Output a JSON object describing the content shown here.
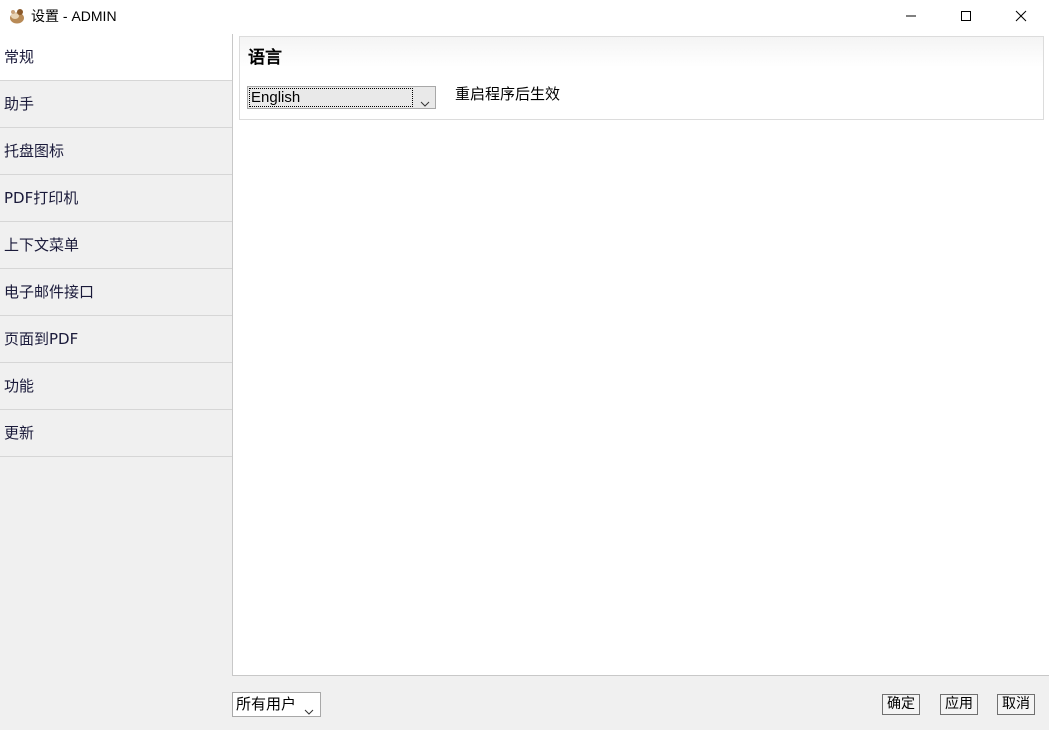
{
  "window": {
    "title": "设置 - ADMIN"
  },
  "sidebar": {
    "items": [
      {
        "label": "常规",
        "active": true
      },
      {
        "label": "助手"
      },
      {
        "label": "托盘图标"
      },
      {
        "label": "PDF打印机"
      },
      {
        "label": "上下文菜单"
      },
      {
        "label": "电子邮件接口"
      },
      {
        "label": "页面到PDF"
      },
      {
        "label": "功能"
      },
      {
        "label": "更新"
      }
    ]
  },
  "language": {
    "group_title": "语言",
    "selected": "English",
    "note": "重启程序后生效"
  },
  "footer": {
    "scope_selected": "所有用户",
    "ok_label": "确定",
    "apply_label": "应用",
    "cancel_label": "取消"
  },
  "icons": {
    "app": "app-logo-icon",
    "minimize": "minimize-icon",
    "maximize": "maximize-icon",
    "close": "close-icon",
    "dropdown": "chevron-down-icon"
  }
}
